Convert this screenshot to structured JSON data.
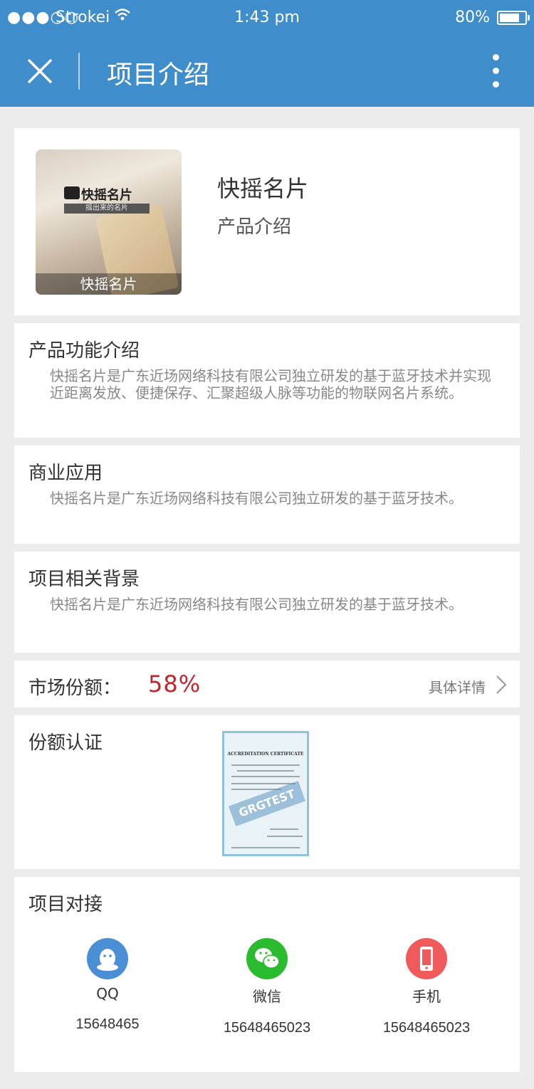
{
  "status_bar": {
    "signal": "●●●○○",
    "carrier": "Strokei",
    "time": "1:43 pm",
    "battery": "80%",
    "battery_level": 0.8
  },
  "nav": {
    "title": "项目介绍"
  },
  "product": {
    "thumb_caption": "快摇名片",
    "thumb_logo_text": "快摇名片",
    "thumb_tag": "摇出来的名片",
    "name": "快摇名片",
    "subtitle": "产品介绍"
  },
  "sections": [
    {
      "title": "产品功能介绍",
      "body": "快摇名片是广东近场网络科技有限公司独立研发的基于蓝牙技术并实现近距离发放、便捷保存、汇聚超级人脉等功能的物联网名片系统。"
    },
    {
      "title": "商业应用",
      "body": "快摇名片是广东近场网络科技有限公司独立研发的基于蓝牙技术。"
    },
    {
      "title": "项目相关背景",
      "body": "快摇名片是广东近场网络科技有限公司独立研发的基于蓝牙技术。"
    }
  ],
  "market": {
    "label": "市场份额：",
    "value": "58%",
    "detail": "具体详情"
  },
  "certification": {
    "title": "份额认证",
    "cert_heading": "ACCREDITATION CERTIFICATE",
    "cert_stamp": "GRGTEST"
  },
  "contacts": {
    "title": "项目对接",
    "items": [
      {
        "name": "QQ",
        "number": "15648465",
        "icon": "qq-icon",
        "color": "#4a8fd6"
      },
      {
        "name": "微信",
        "number": "15648465023",
        "icon": "wechat-icon",
        "color": "#2bbb2e"
      },
      {
        "name": "手机",
        "number": "15648465023",
        "icon": "phone-icon",
        "color": "#f05a5a"
      }
    ]
  }
}
